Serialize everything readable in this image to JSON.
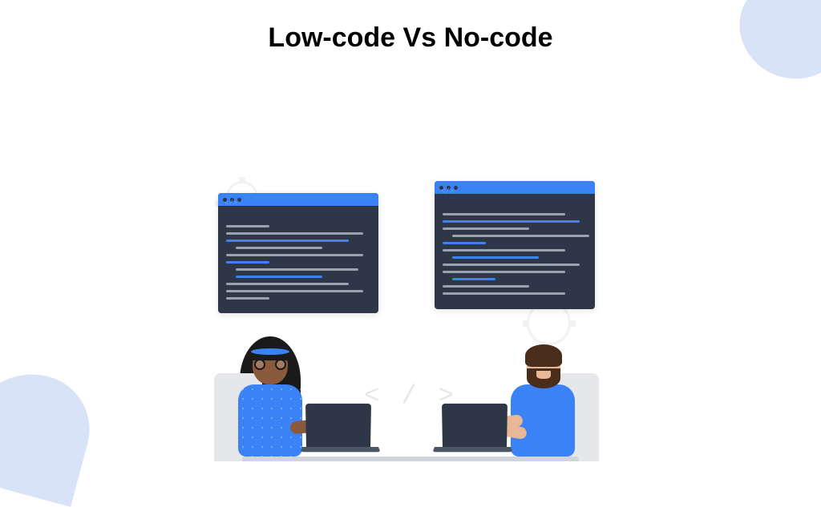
{
  "title": "Low-code Vs No-code",
  "code_symbol": "< / >",
  "colors": {
    "accent": "#3b82f6",
    "blob": "#d9e3f8",
    "editor_bg": "#2d3748"
  }
}
